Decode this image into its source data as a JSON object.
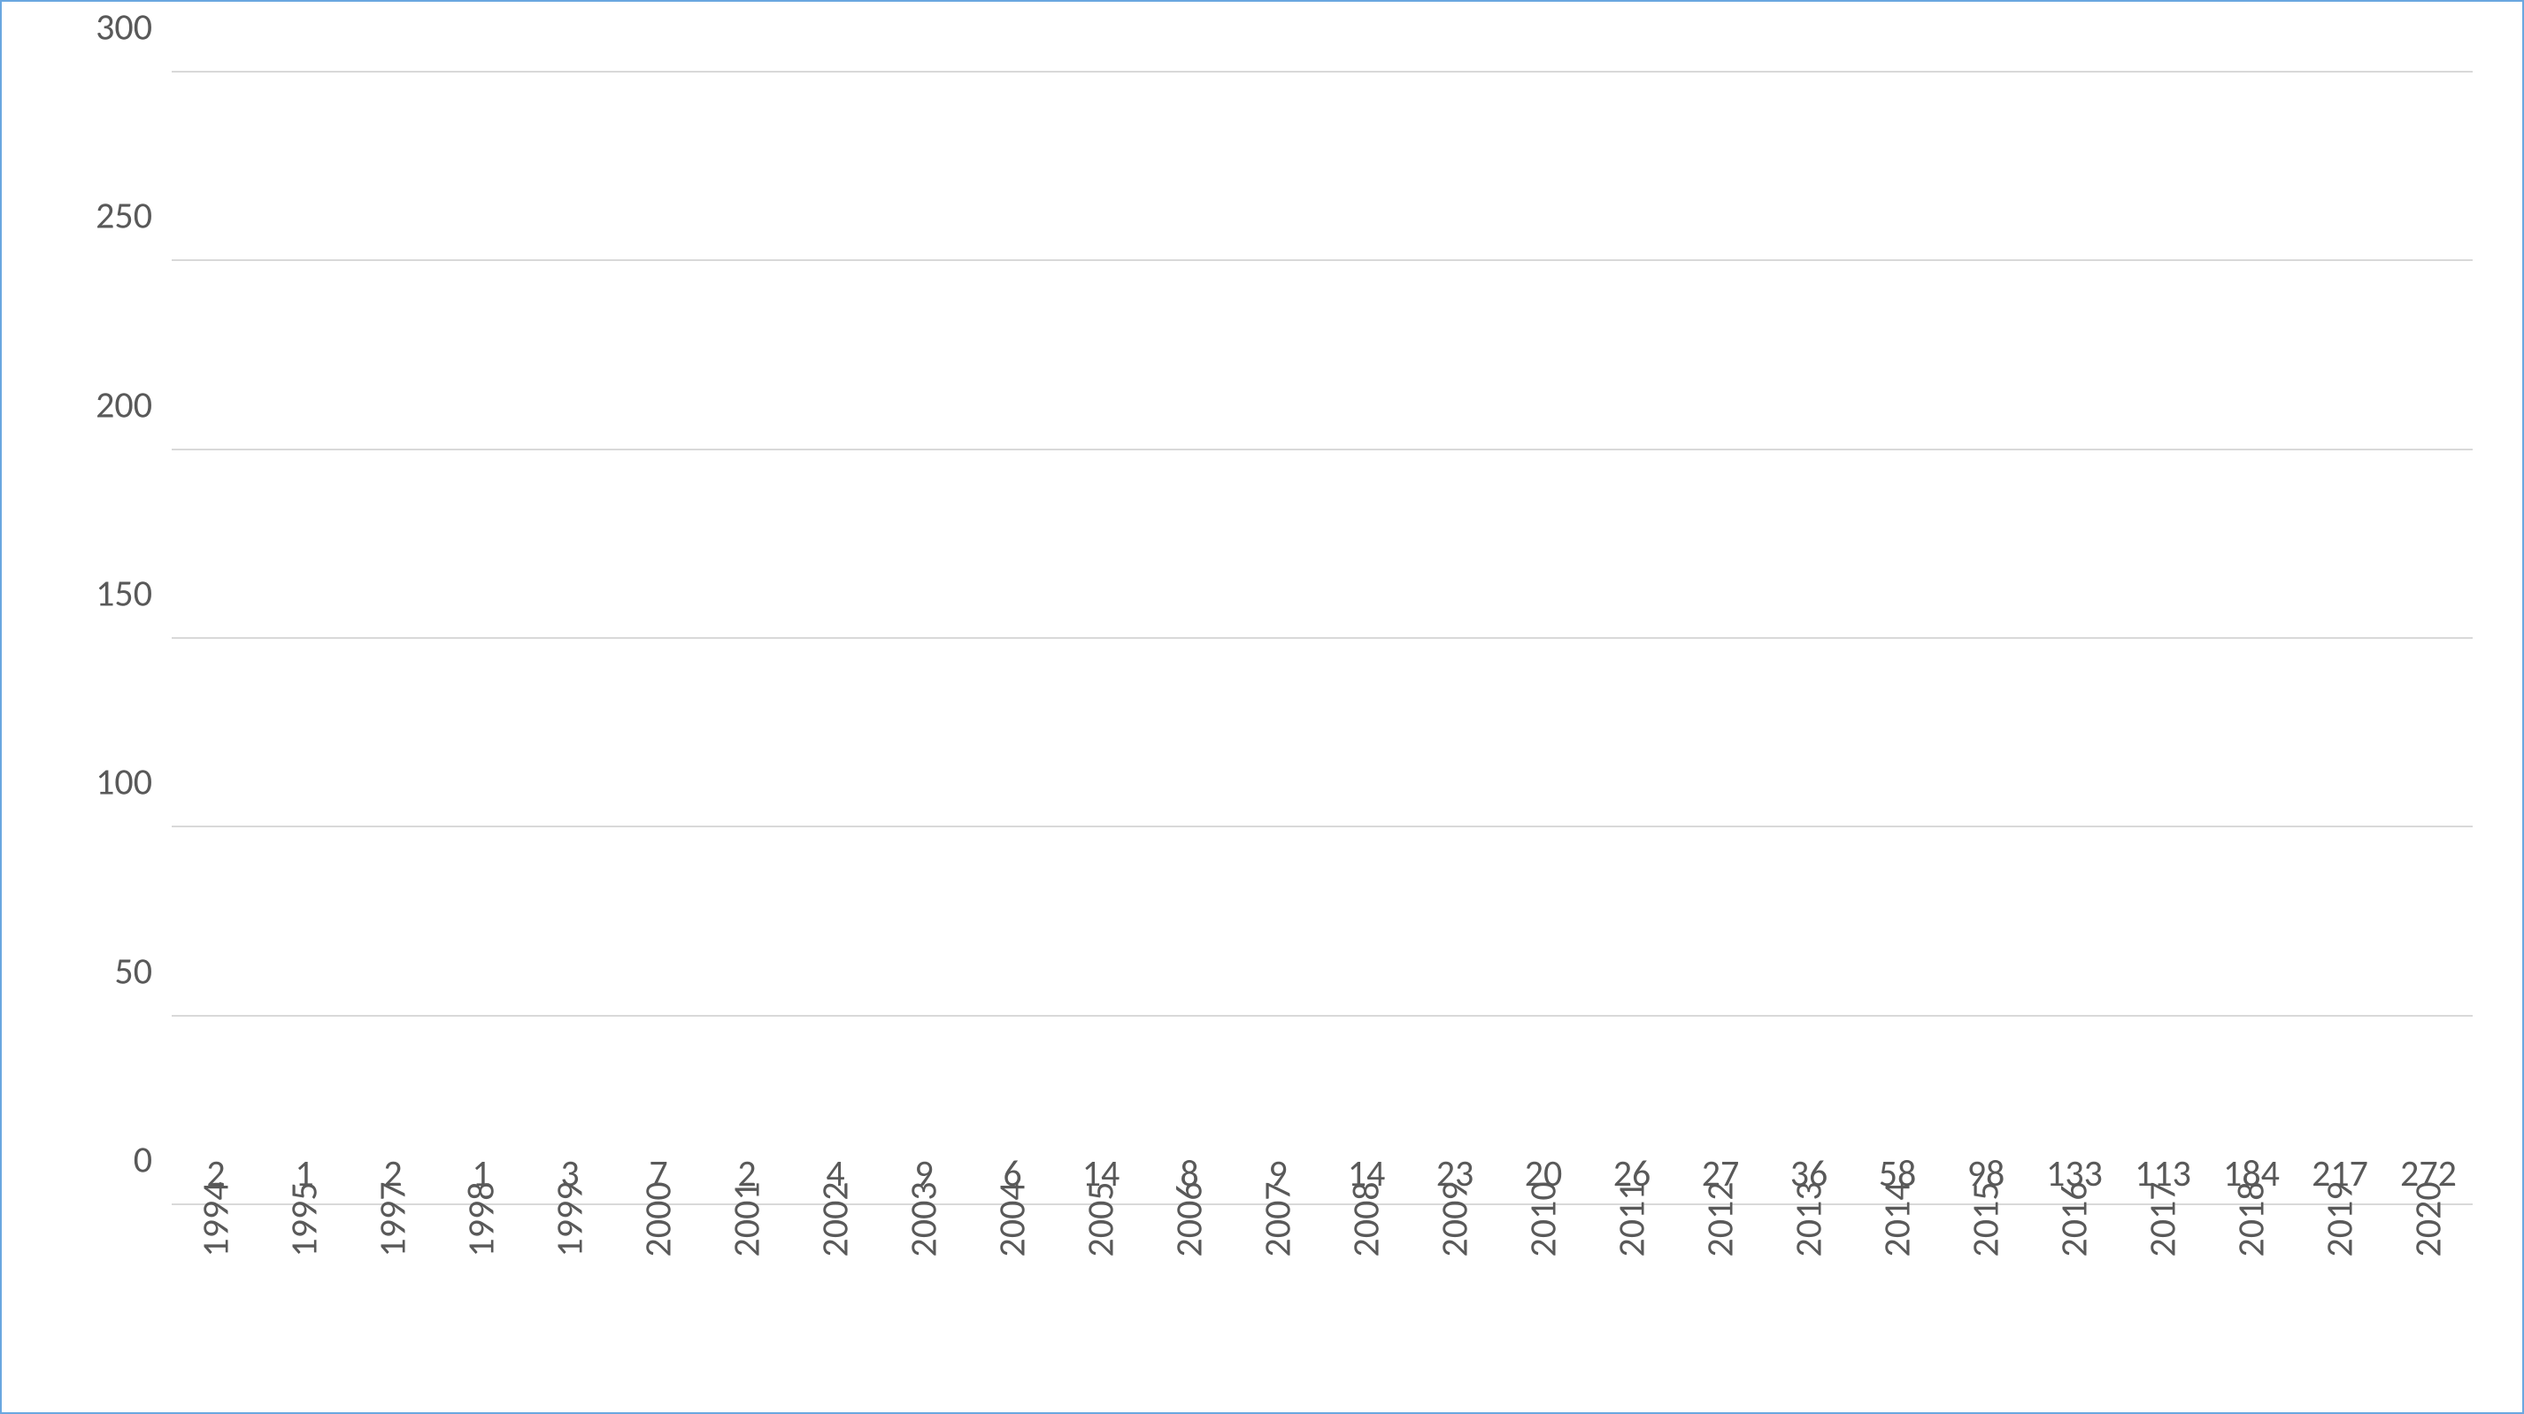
{
  "chart_data": {
    "type": "bar",
    "categories": [
      "1994",
      "1995",
      "1997",
      "1998",
      "1999",
      "2000",
      "2001",
      "2002",
      "2003",
      "2004",
      "2005",
      "2006",
      "2007",
      "2008",
      "2009",
      "2010",
      "2011",
      "2012",
      "2013",
      "2014",
      "2015",
      "2016",
      "2017",
      "2018",
      "2019",
      "2020"
    ],
    "values": [
      2,
      1,
      2,
      1,
      3,
      7,
      2,
      4,
      9,
      6,
      14,
      8,
      9,
      14,
      23,
      20,
      26,
      27,
      36,
      58,
      98,
      133,
      113,
      184,
      217,
      272
    ],
    "ylim": [
      0,
      300
    ],
    "y_ticks": [
      0,
      50,
      100,
      150,
      200,
      250,
      300
    ],
    "bar_color": "#ed7d31",
    "title": "",
    "xlabel": "",
    "ylabel": ""
  }
}
